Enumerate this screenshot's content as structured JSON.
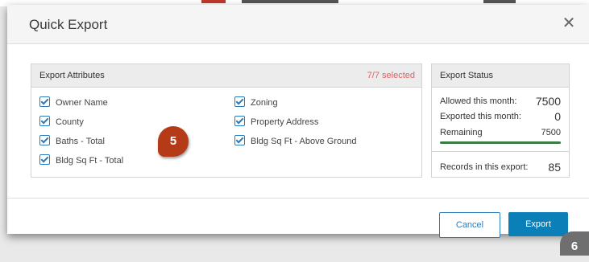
{
  "dialog": {
    "title": "Quick Export",
    "close_glyph": "✕"
  },
  "attributes_panel": {
    "title": "Export Attributes",
    "selected_count": "7/7 selected",
    "items": [
      {
        "label": "Owner Name",
        "checked": true
      },
      {
        "label": "County",
        "checked": true
      },
      {
        "label": "Baths - Total",
        "checked": true
      },
      {
        "label": "Bldg Sq Ft - Total",
        "checked": true
      },
      {
        "label": "Zoning",
        "checked": true
      },
      {
        "label": "Property Address",
        "checked": true
      },
      {
        "label": "Bldg Sq Ft - Above Ground",
        "checked": true
      }
    ]
  },
  "status_panel": {
    "title": "Export Status",
    "allowed_label": "Allowed this month:",
    "allowed_value": "7500",
    "exported_label": "Exported this month:",
    "exported_value": "0",
    "remaining_label": "Remaining",
    "remaining_value": "7500",
    "remaining_fraction": 1.0,
    "records_label": "Records in this export:",
    "records_value": "85"
  },
  "buttons": {
    "cancel_label": "Cancel",
    "export_label": "Export"
  },
  "callouts": {
    "step5": "5",
    "step6": "6"
  },
  "colors": {
    "primary": "#0a7fb8",
    "callout": "#b53a17",
    "progress": "#3a7d44",
    "selected_count": "#e06060"
  }
}
